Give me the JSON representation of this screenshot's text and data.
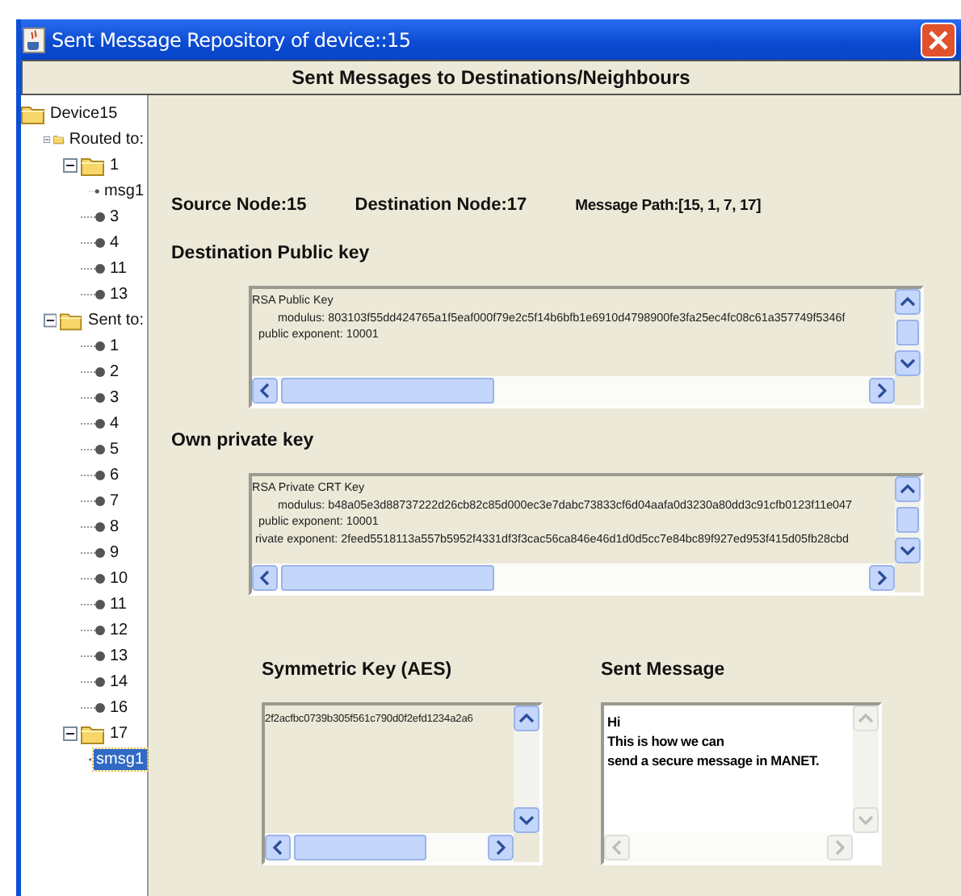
{
  "window": {
    "title": "Sent Message Repository of device::15"
  },
  "header": "Sent Messages to Destinations/Neighbours",
  "tree": [
    {
      "label": "Device15",
      "kind": "folder",
      "selected": false,
      "children": [
        {
          "label": "Routed to:",
          "kind": "folder",
          "expanded": true,
          "selected": false,
          "children": [
            {
              "label": "1",
              "kind": "folder",
              "expanded": true,
              "selected": false,
              "children": [
                {
                  "label": "msg1",
                  "kind": "leaf",
                  "selected": false
                }
              ]
            },
            {
              "label": "3",
              "kind": "leaf",
              "selected": false
            },
            {
              "label": "4",
              "kind": "leaf",
              "selected": false
            },
            {
              "label": "11",
              "kind": "leaf",
              "selected": false
            },
            {
              "label": "13",
              "kind": "leaf",
              "selected": false
            }
          ]
        },
        {
          "label": "Sent to:",
          "kind": "folder",
          "expanded": true,
          "selected": false,
          "children": [
            {
              "label": "1",
              "kind": "leaf",
              "selected": false
            },
            {
              "label": "2",
              "kind": "leaf",
              "selected": false
            },
            {
              "label": "3",
              "kind": "leaf",
              "selected": false
            },
            {
              "label": "4",
              "kind": "leaf",
              "selected": false
            },
            {
              "label": "5",
              "kind": "leaf",
              "selected": false
            },
            {
              "label": "6",
              "kind": "leaf",
              "selected": false
            },
            {
              "label": "7",
              "kind": "leaf",
              "selected": false
            },
            {
              "label": "8",
              "kind": "leaf",
              "selected": false
            },
            {
              "label": "9",
              "kind": "leaf",
              "selected": false
            },
            {
              "label": "10",
              "kind": "leaf",
              "selected": false
            },
            {
              "label": "11",
              "kind": "leaf",
              "selected": false
            },
            {
              "label": "12",
              "kind": "leaf",
              "selected": false
            },
            {
              "label": "13",
              "kind": "leaf",
              "selected": false
            },
            {
              "label": "14",
              "kind": "leaf",
              "selected": false
            },
            {
              "label": "16",
              "kind": "leaf",
              "selected": false
            },
            {
              "label": "17",
              "kind": "folder",
              "expanded": true,
              "selected": false,
              "children": [
                {
                  "label": "smsg1",
                  "kind": "leaf",
                  "selected": true
                }
              ]
            }
          ]
        }
      ]
    }
  ],
  "info": [
    {
      "kind": "node",
      "text": "Source Node:15"
    },
    {
      "kind": "node",
      "text": "Destination Node:17"
    },
    {
      "kind": "path",
      "text": "Message Path:[15, 1, 7, 17]"
    }
  ],
  "public_key": {
    "label": "Destination Public key",
    "editable": false,
    "scrollbars_enabled": true,
    "lines": [
      "RSA Public Key",
      "        modulus: 803103f55dd424765a1f5eaf000f79e2c5f14b6bfb1e6910d4798900fe3fa25ec4fc08c61a357749f5346f",
      "  public exponent: 10001"
    ]
  },
  "private_key": {
    "label": "Own private key",
    "editable": false,
    "scrollbars_enabled": true,
    "lines": [
      "RSA Private CRT Key",
      "        modulus: b48a05e3d88737222d26cb82c85d000ec3e7dabc73833cf6d04aafa0d3230a80dd3c91cfb0123f11e047",
      "  public exponent: 10001",
      " rivate exponent: 2feed5518113a557b5952f4331df3f3cac56ca846e46d1d0d5cc7e84bc89f927ed953f415d05fb28cbd"
    ]
  },
  "symmetric_key": {
    "label": "Symmetric Key (AES)",
    "editable": false,
    "scrollbars_enabled": true,
    "lines": [
      "2f2acfbc0739b305f561c790d0f2efd1234a2a6"
    ]
  },
  "sent_message": {
    "label": "Sent Message",
    "editable": true,
    "scrollbars_enabled": false,
    "lines": [
      "Hi",
      "This is how we can",
      "send a secure message in MANET."
    ]
  }
}
